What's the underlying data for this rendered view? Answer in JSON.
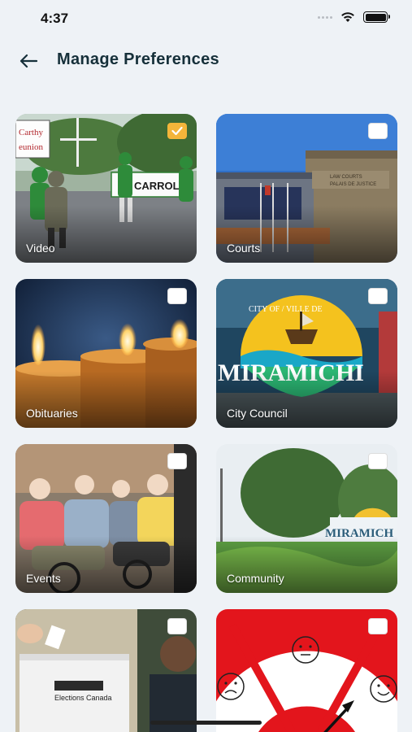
{
  "status": {
    "time": "4:37"
  },
  "header": {
    "title": "Manage Preferences"
  },
  "cards": [
    {
      "label": "Video",
      "checked": true,
      "sign_text": [
        "Carthy",
        "eunion"
      ],
      "banner_text": "CARROLLS"
    },
    {
      "label": "Courts",
      "checked": false,
      "plaque_text": [
        "LAW COURTS",
        "PALAIS DE JUSTICE"
      ]
    },
    {
      "label": "Obituaries",
      "checked": false
    },
    {
      "label": "City Council",
      "checked": false,
      "logo_text": "MIRAMICHI",
      "arc_text": "CITY OF / VILLE DE"
    },
    {
      "label": "Events",
      "checked": false
    },
    {
      "label": "Community",
      "checked": false,
      "sign_text": "MIRAMICH"
    },
    {
      "label": "",
      "checked": false,
      "box_text": "Elections Canada"
    },
    {
      "label": "",
      "checked": false
    }
  ],
  "colors": {
    "accent": "#f4b53a",
    "title": "#16303a",
    "background": "#eef2f6"
  }
}
